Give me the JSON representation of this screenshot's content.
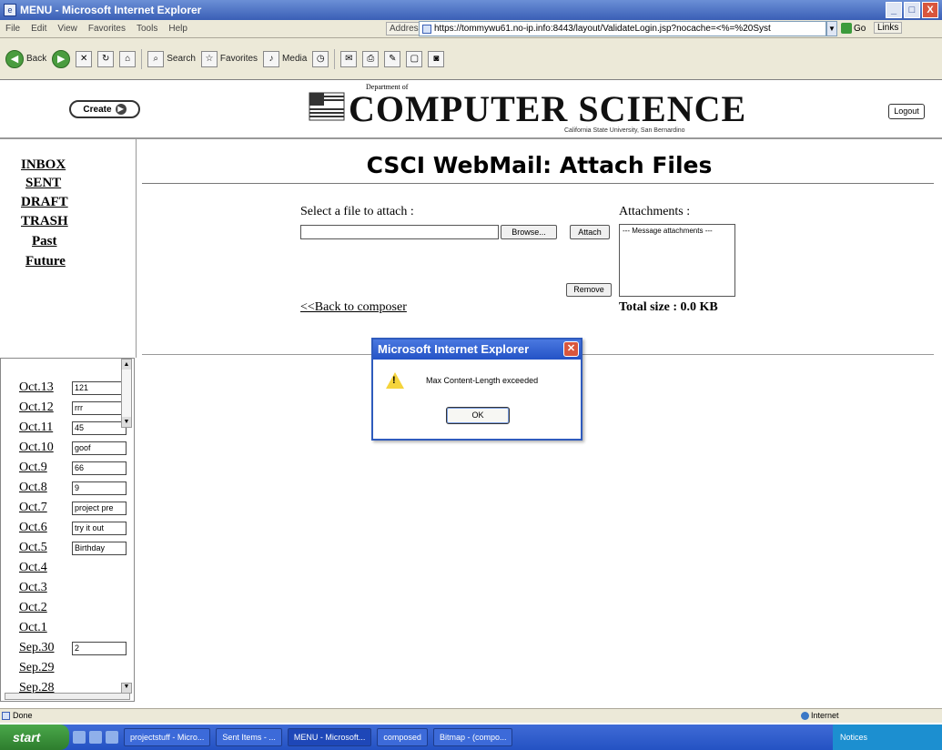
{
  "window": {
    "title": "MENU - Microsoft Internet Explorer",
    "buttons": {
      "minimize": "_",
      "maximize": "□",
      "close": "X"
    }
  },
  "menubar": {
    "items": [
      "File",
      "Edit",
      "View",
      "Favorites",
      "Tools",
      "Help"
    ],
    "address_label": "Address",
    "address_url": "https://tommywu61.no-ip.info:8443/layout/ValidateLogin.jsp?nocache=<%=%20Syst",
    "go_label": "Go",
    "links_label": "Links"
  },
  "toolbar": {
    "back": "Back",
    "search": "Search",
    "favorites": "Favorites",
    "media": "Media"
  },
  "header": {
    "create_label": "Create",
    "department": "Department of",
    "brand": "COMPUTER SCIENCE",
    "university": "California State University, San Bernardino",
    "logout_label": "Logout"
  },
  "nav": {
    "items": [
      {
        "label": "INBOX"
      },
      {
        "label": "SENT"
      },
      {
        "label": "DRAFT"
      },
      {
        "label": "TRASH"
      },
      {
        "label": "Past"
      },
      {
        "label": "Future"
      }
    ]
  },
  "dates": [
    {
      "label": "Oct.13",
      "note": "121"
    },
    {
      "label": "Oct.12",
      "note": "rrr"
    },
    {
      "label": "Oct.11",
      "note": "45"
    },
    {
      "label": "Oct.10",
      "note": "goof"
    },
    {
      "label": "Oct.9",
      "note": "66"
    },
    {
      "label": "Oct.8",
      "note": "9"
    },
    {
      "label": "Oct.7",
      "note": "project pre"
    },
    {
      "label": "Oct.6",
      "note": "try it out"
    },
    {
      "label": "Oct.5",
      "note": "Birthday"
    },
    {
      "label": "Oct.4",
      "note": ""
    },
    {
      "label": "Oct.3",
      "note": ""
    },
    {
      "label": "Oct.2",
      "note": ""
    },
    {
      "label": "Oct.1",
      "note": ""
    },
    {
      "label": "Sep.30",
      "note": "2"
    },
    {
      "label": "Sep.29",
      "note": ""
    },
    {
      "label": "Sep.28",
      "note": ""
    }
  ],
  "main": {
    "title": "CSCI WebMail: Attach Files",
    "select_label": "Select a file to attach :",
    "browse_label": "Browse...",
    "attach_label": "Attach",
    "attachments_label": "Attachments :",
    "attachments_placeholder": "--- Message attachments ---",
    "remove_label": "Remove",
    "back_link": "<<Back to composer",
    "total_size": "Total size : 0.0 KB"
  },
  "dialog": {
    "title": "Microsoft Internet Explorer",
    "message": "Max Content-Length exceeded",
    "ok_label": "OK"
  },
  "statusbar": {
    "status": "Done",
    "zone": "Internet"
  },
  "taskbar": {
    "start": "start",
    "tasks": [
      "projectstuff - Micro...",
      "Sent Items - ...",
      "MENU - Microsoft...",
      "composed",
      "Bitmap - (compo..."
    ],
    "clock": "Notices"
  }
}
